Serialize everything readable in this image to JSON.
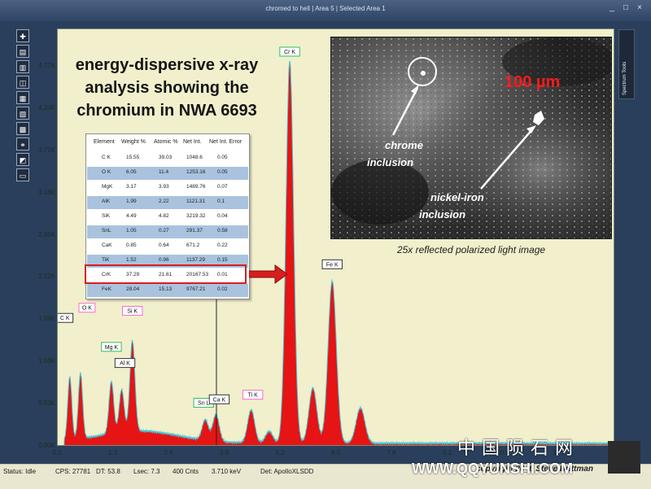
{
  "window": {
    "title": "chromed to hell | Area 5 | Selected Area 1",
    "buttons": {
      "minimize": "_",
      "maximize": "□",
      "close": "×"
    }
  },
  "toolbar": {
    "tools": [
      "✚",
      "▤",
      "▥",
      "◫",
      "▦",
      "▧",
      "▩",
      "⚭",
      "◩",
      "▭",
      "⎙"
    ]
  },
  "annotations": {
    "heading": [
      "energy-dispersive x-ray",
      "analysis showing the",
      "chromium in NWA 6693"
    ],
    "image": {
      "scale": "100 µm",
      "chrome_label": [
        "chrome",
        "inclusion"
      ],
      "nickel_label": [
        "nickel-iron",
        "inclusion"
      ],
      "caption": "25x reflected polarized light image"
    },
    "side_tab": "Spectrum Tools"
  },
  "table": {
    "headers": [
      "Element",
      "Weight %",
      "Atomic %",
      "Net Int.",
      "Net Int. Error"
    ],
    "rows": [
      [
        "C K",
        "15.55",
        "39.03",
        "1048.6",
        "0.05"
      ],
      [
        "O K",
        "6.05",
        "11.4",
        "1253.16",
        "0.05"
      ],
      [
        "MgK",
        "3.17",
        "3.93",
        "1489.76",
        "0.07"
      ],
      [
        "AlK",
        "1.99",
        "2.22",
        "1121.31",
        "0.1"
      ],
      [
        "SiK",
        "4.49",
        "4.82",
        "3219.32",
        "0.04"
      ],
      [
        "SnL",
        "1.05",
        "0.27",
        "291.37",
        "0.58"
      ],
      [
        "CaK",
        "0.85",
        "0.64",
        "671.2",
        "0.22"
      ],
      [
        "TiK",
        "1.52",
        "0.96",
        "1137.29",
        "0.15"
      ],
      [
        "CrK",
        "37.29",
        "21.61",
        "20167.53",
        "0.01"
      ],
      [
        "FeK",
        "28.04",
        "15.13",
        "9767.21",
        "0.02"
      ]
    ]
  },
  "chart_data": {
    "type": "area",
    "x_ticks": [
      "0.0",
      "1.3",
      "2.6",
      "3.9",
      "5.2",
      "6.5",
      "7.8",
      "9.1",
      "10.4",
      "11.7"
    ],
    "y_ticks": [
      "0.00K",
      "0.53K",
      "1.06K",
      "1.59K",
      "2.12K",
      "2.65K",
      "3.18K",
      "3.71K",
      "4.24K",
      "4.77K"
    ],
    "xlim": [
      0,
      13
    ],
    "ylim": [
      0,
      5300
    ],
    "cursor_x": 3.7,
    "peaks": [
      {
        "label": "C K",
        "x": 0.28,
        "y": 800
      },
      {
        "label": "O K",
        "x": 0.53,
        "y": 830
      },
      {
        "label": "Mg K",
        "x": 1.25,
        "y": 660
      },
      {
        "label": "Al K",
        "x": 1.49,
        "y": 540
      },
      {
        "label": "Si K",
        "x": 1.74,
        "y": 1150
      },
      {
        "label": "Sn L",
        "x": 3.44,
        "y": 260
      },
      {
        "label": "Ca K",
        "x": 3.69,
        "y": 340
      },
      {
        "label": "Ti K",
        "x": 4.51,
        "y": 420
      },
      {
        "label": "Cr K",
        "x": 5.41,
        "y": 4850
      },
      {
        "label": "Fe K",
        "x": 6.4,
        "y": 2060
      }
    ],
    "unlabeled_peaks": [
      {
        "x": 4.93,
        "y": 150
      },
      {
        "x": 5.95,
        "y": 700
      },
      {
        "x": 7.06,
        "y": 450
      }
    ]
  },
  "status": {
    "state": "Status: Idle",
    "cps": "CPS: 27781",
    "dt": "DT: 53.8",
    "lsec": "Lsec: 7.3",
    "cnts": "400 Cnts",
    "kev": "3.710 keV",
    "det": "Det: ApolloXLSDD"
  },
  "watermark": {
    "copyright": "copyright 20_6 Steve Brittman",
    "cn": "中国陨石网",
    "url": "WWW.QQYUNSHI.COM"
  },
  "colors": {
    "plot_bg": "#f1efcc",
    "spectrum_fill": "#e61414",
    "outline": "#45c6d6",
    "label_border": "#444444"
  }
}
